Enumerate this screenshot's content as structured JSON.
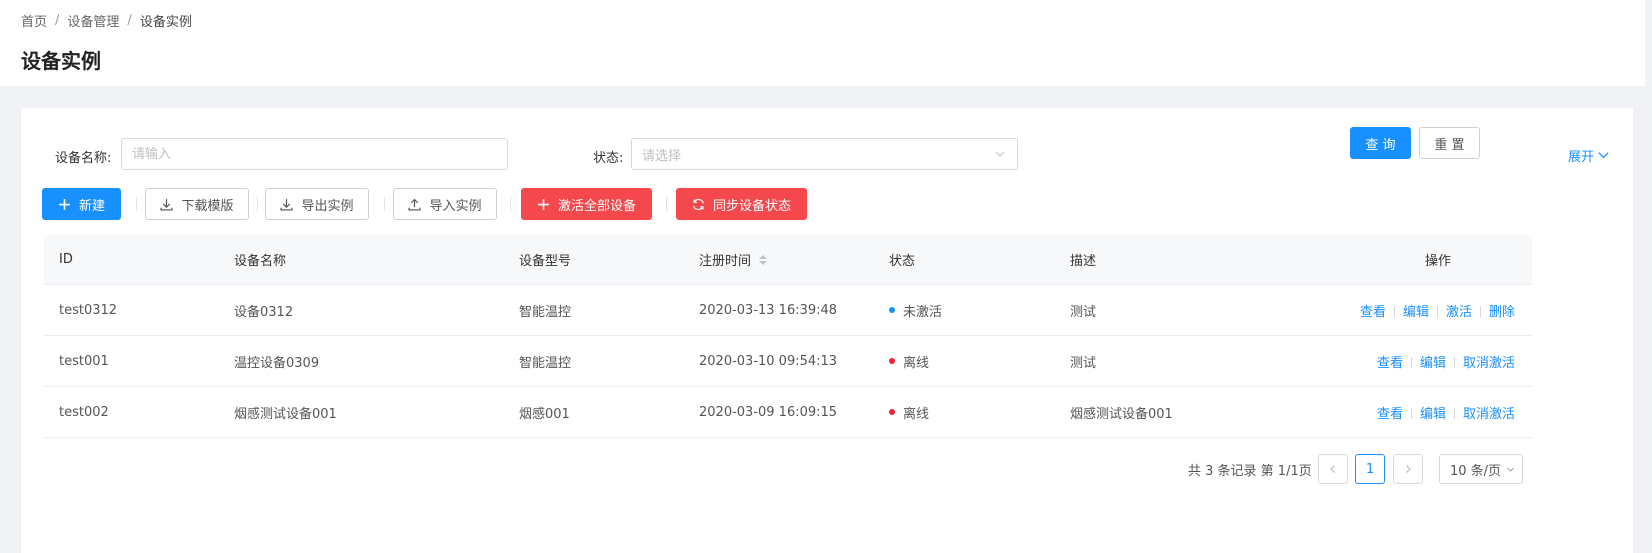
{
  "breadcrumb": {
    "items": [
      "首页",
      "设备管理",
      "设备实例"
    ],
    "separator": "/"
  },
  "page": {
    "title": "设备实例"
  },
  "search": {
    "name_label": "设备名称:",
    "name_placeholder": "请输入",
    "status_label": "状态:",
    "status_placeholder": "请选择",
    "query_label": "查 询",
    "reset_label": "重 置",
    "expand_label": "展开"
  },
  "toolbar": {
    "new_label": "新建",
    "download_template_label": "下载模版",
    "export_label": "导出实例",
    "import_label": "导入实例",
    "activate_all_label": "激活全部设备",
    "sync_status_label": "同步设备状态"
  },
  "table": {
    "columns": {
      "id": "ID",
      "name": "设备名称",
      "type": "设备型号",
      "time": "注册时间",
      "status": "状态",
      "desc": "描述",
      "ops": "操作"
    },
    "rows": [
      {
        "id": "test0312",
        "name": "设备0312",
        "type": "智能温控",
        "time": "2020-03-13 16:39:48",
        "status": "未激活",
        "status_color": "#1890ff",
        "desc": "测试",
        "ops": [
          "查看",
          "编辑",
          "激活",
          "删除"
        ]
      },
      {
        "id": "test001",
        "name": "温控设备0309",
        "type": "智能温控",
        "time": "2020-03-10 09:54:13",
        "status": "离线",
        "status_color": "#f5222d",
        "desc": "测试",
        "ops": [
          "查看",
          "编辑",
          "取消激活"
        ]
      },
      {
        "id": "test002",
        "name": "烟感测试设备001",
        "type": "烟感001",
        "time": "2020-03-09 16:09:15",
        "status": "离线",
        "status_color": "#f5222d",
        "desc": "烟感测试设备001",
        "ops": [
          "查看",
          "编辑",
          "取消激活"
        ]
      }
    ]
  },
  "pagination": {
    "total_text": "共 3 条记录 第 1/1页",
    "current_page": "1",
    "page_size": "10 条/页"
  },
  "colors": {
    "primary": "#1890ff",
    "danger": "#f5484d"
  }
}
